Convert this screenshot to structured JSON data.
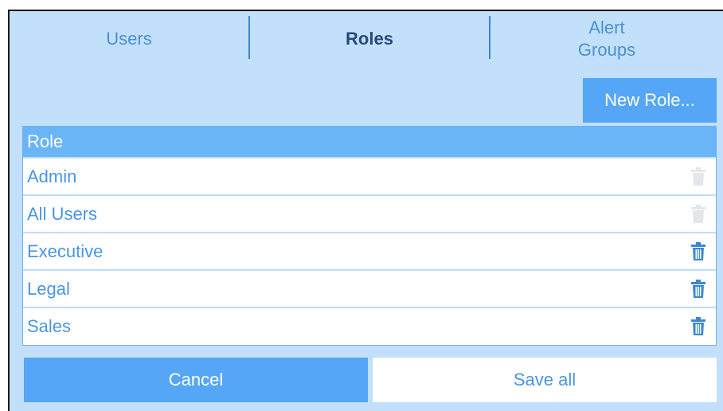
{
  "tabs": [
    {
      "label": "Users",
      "active": false
    },
    {
      "label": "Roles",
      "active": true
    },
    {
      "label_line1": "Alert",
      "label_line2": "Groups",
      "active": false
    }
  ],
  "toolbar": {
    "new_role_label": "New Role..."
  },
  "table": {
    "header": "Role",
    "rows": [
      {
        "name": "Admin",
        "delete_enabled": false
      },
      {
        "name": "All Users",
        "delete_enabled": false
      },
      {
        "name": "Executive",
        "delete_enabled": true
      },
      {
        "name": "Legal",
        "delete_enabled": true
      },
      {
        "name": "Sales",
        "delete_enabled": true
      }
    ]
  },
  "footer": {
    "cancel_label": "Cancel",
    "save_label": "Save all"
  },
  "colors": {
    "accent": "#55a6f6",
    "panel_bg": "#c2e0fb",
    "trash_enabled": "#3d86d4",
    "trash_disabled": "#e3e7eb"
  }
}
